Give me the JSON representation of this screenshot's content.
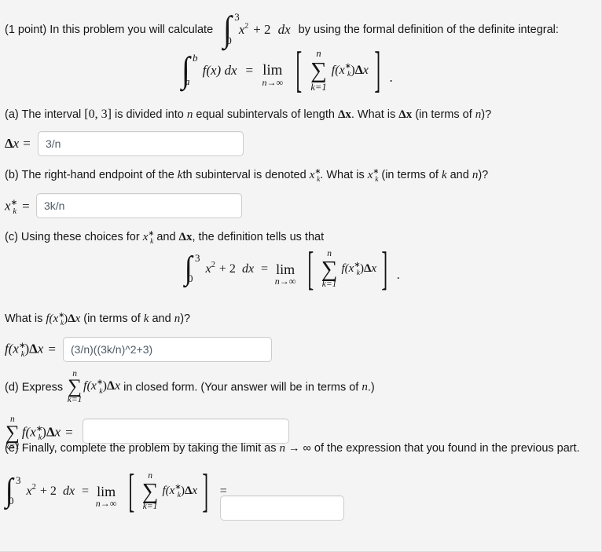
{
  "problem": {
    "intro_prefix": "(1 point) In this problem you will calculate",
    "intro_suffix": "by using the formal definition of the definite integral:",
    "integral_lower": "0",
    "integral_upper": "3",
    "integrand": "x",
    "integrand_exp": "2",
    "integrand_tail": "+ 2",
    "dx": "dx"
  },
  "definition_formula": {
    "int_sign": "∫",
    "lower": "a",
    "upper": "b",
    "fx_dx": "f(x) dx",
    "equals": "=",
    "lim": "lim",
    "lim_sub": "n→∞",
    "bracket_open": "[",
    "bracket_close": "]",
    "sum_sign": "∑",
    "sum_upper": "n",
    "sum_lower": "k=1",
    "summand_f": "f(x",
    "summand_star": "∗",
    "summand_k": "k",
    "summand_close": ")",
    "delta": "Δ",
    "delta_var": "x",
    "period": "."
  },
  "parts": {
    "a": {
      "question_1": "(a) The interval ",
      "interval": "[0, 3]",
      "question_2": " is divided into ",
      "n1": "n",
      "question_3": " equal subintervals of length ",
      "dx1": "Δx",
      "question_4": ". What is ",
      "dx2": "Δx",
      "question_5": " (in terms of ",
      "n2": "n",
      "question_6": ")?",
      "label_delta": "Δ",
      "label_x": "x",
      "label_eq": "=",
      "value": "3/n",
      "placeholder": ""
    },
    "b": {
      "question_1": "(b) The right-hand endpoint of the ",
      "k1": "k",
      "question_2": "th subinterval is denoted ",
      "question_3": ". What is ",
      "question_4": " (in terms of ",
      "k2": "k",
      "question_5": " and ",
      "n1": "n",
      "question_6": ")?",
      "label_eq": "=",
      "value": "3k/n",
      "placeholder": ""
    },
    "c": {
      "question_1": "(c) Using these choices for ",
      "question_2": " and ",
      "dx1": "Δx",
      "question_3": ", the definition tells us that",
      "sub_question_1": "What is ",
      "sub_question_2": " (in terms of ",
      "k1": "k",
      "sub_question_3": " and ",
      "n1": "n",
      "sub_question_4": ")?",
      "label_eq": "=",
      "value": "(3/n)((3k/n)^2+3)",
      "placeholder": ""
    },
    "d": {
      "question_1": "(d) Express ",
      "question_2": " in closed form. (Your answer will be in terms of ",
      "n1": "n",
      "question_3": ".)",
      "label_eq": "=",
      "value": "",
      "placeholder": ""
    },
    "e": {
      "question_1": "(e) Finally, complete the problem by taking the limit as ",
      "n1": "n",
      "arrow": " → ∞",
      "question_2": " of the expression that you found in the previous part.",
      "label_eq": "=",
      "value": "",
      "placeholder": ""
    }
  },
  "symbols": {
    "integral": "∫",
    "sum": "∑",
    "delta": "Δ",
    "star": "∗",
    "infinity": "∞",
    "arrow_right": "→",
    "equals": "=",
    "period": ".",
    "bracket_open": "[",
    "bracket_close": "]",
    "lim": "lim",
    "zero": "0",
    "three": "3",
    "two": "2",
    "n": "n",
    "k": "k",
    "k_eq_1": "k=1",
    "n_to_inf": "n→∞",
    "a": "a",
    "b": "b",
    "x": "x",
    "f_open": "f(x",
    "close_paren": ")",
    "dx": "dx",
    "fx_dx": "f(x) dx",
    "x_sq_plus_2_dx": "+ 2 dx",
    "interval_03": "[0, 3]",
    "delta_x": "Δx"
  },
  "colors": {
    "background": "#f4f4f4",
    "text": "#161616",
    "input_border": "#cccccc",
    "input_background": "#ffffff",
    "input_text": "#4e5b66"
  }
}
